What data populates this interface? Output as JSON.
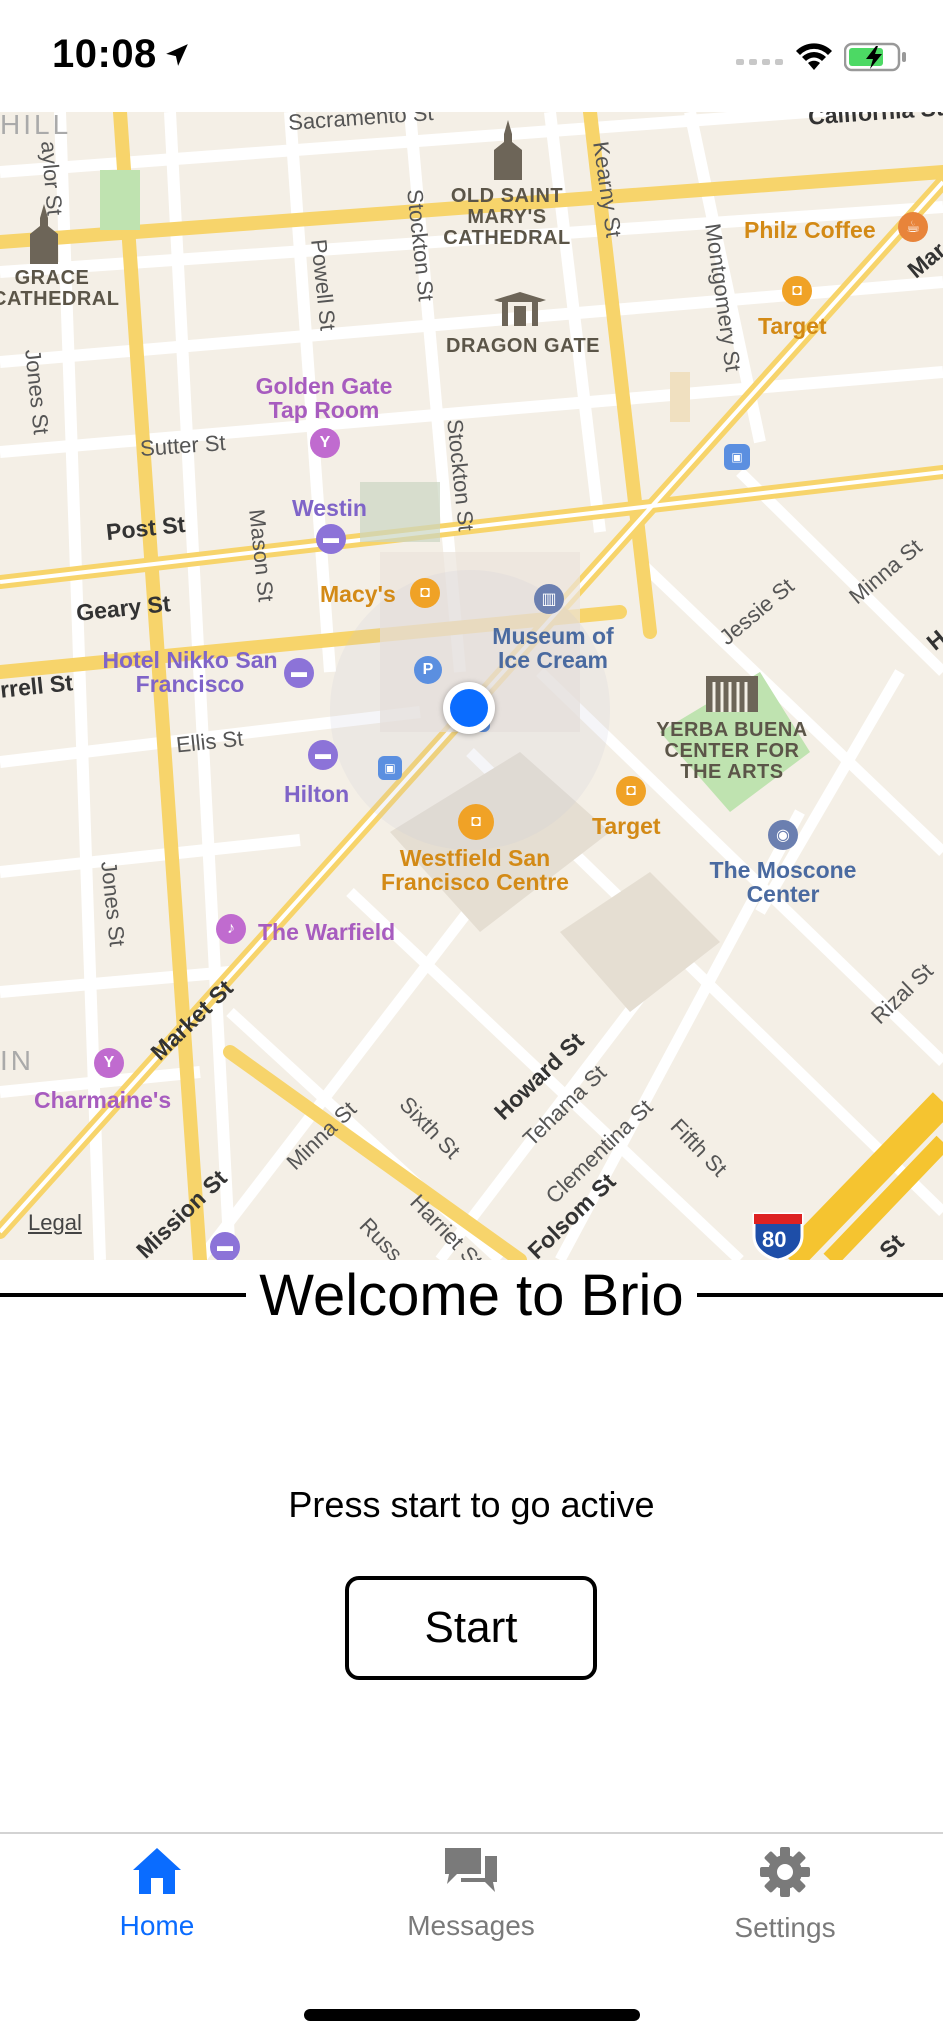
{
  "status_bar": {
    "time": "10:08",
    "icons": [
      "location-arrow-icon",
      "cellular-signal-icon",
      "wifi-icon",
      "battery-charging-icon"
    ]
  },
  "map": {
    "legal": "Legal",
    "streets": {
      "sacramento": "Sacramento St",
      "california": "California St",
      "taylor": "aylor St",
      "kearny": "Kearny St",
      "stockton_upper": "Stockton St",
      "powell": "Powell St",
      "montgomery": "Montgomery St",
      "jones_upper": "Jones St",
      "sutter": "Sutter St",
      "stockton_lower": "Stockton St",
      "post": "Post St",
      "mason": "Mason St",
      "geary": "Geary St",
      "jessie": "Jessie St",
      "minna_right": "Minna St",
      "farrell": "rrell St",
      "ellis": "Ellis St",
      "jones_lower": "Jones St",
      "market": "Market St",
      "howard": "Howard St",
      "tehama": "Tehama St",
      "clementina": "Clementina St",
      "rizal": "Rizal St",
      "minna_lower": "Minna St",
      "sixth": "Sixth St",
      "fifth": "Fifth St",
      "mission": "Mission St",
      "folsom": "Folsom St",
      "harriet": "Harriet St",
      "russ": "Russ",
      "mart": "Mar",
      "hill": "HILL",
      "in": "IN",
      "h": "H",
      "st": "St"
    },
    "pois": {
      "old_saint_marys": "OLD SAINT MARY'S CATHEDRAL",
      "grace_cathedral": "GRACE CATHEDRAL",
      "dragon_gate": "DRAGON GATE",
      "philz": "Philz Coffee",
      "target_top": "Target",
      "golden_gate_tap": "Golden Gate Tap Room",
      "westin": "Westin",
      "macys": "Macy's",
      "museum_ice_cream": "Museum of Ice Cream",
      "hotel_nikko": "Hotel Nikko San Francisco",
      "yerba_buena": "YERBA BUENA CENTER FOR THE ARTS",
      "hilton": "Hilton",
      "target_mid": "Target",
      "westfield": "Westfield San Francisco Centre",
      "moscone": "The Moscone Center",
      "warfield": "The Warfield",
      "charmaines": "Charmaine's",
      "interstate": "80"
    }
  },
  "welcome": {
    "title": "Welcome to Brio",
    "prompt": "Press start to go active",
    "start_label": "Start"
  },
  "tabs": [
    {
      "label": "Home",
      "icon": "home-icon",
      "active": true,
      "color": "#0a6cff"
    },
    {
      "label": "Messages",
      "icon": "messages-icon",
      "active": false,
      "color": "#7a7a7a"
    },
    {
      "label": "Settings",
      "icon": "gear-icon",
      "active": false,
      "color": "#7a7a7a"
    }
  ],
  "colors": {
    "accent": "#0a6cff",
    "inactive_tab": "#7a7a7a",
    "map_background": "#f4efe6",
    "major_road": "#f7d46b"
  }
}
